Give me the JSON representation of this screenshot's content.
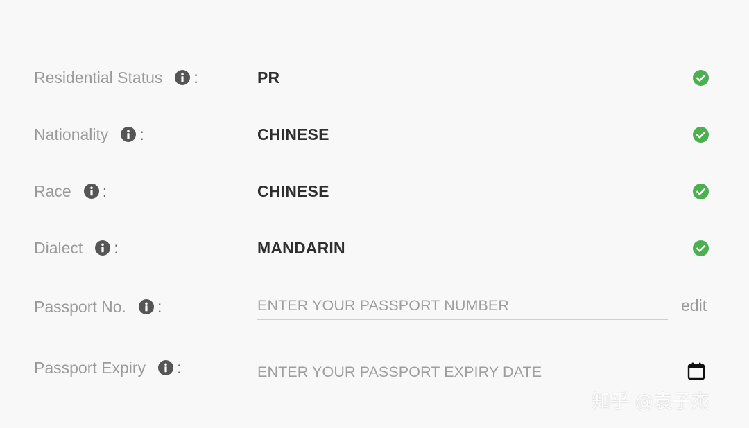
{
  "fields": [
    {
      "label": "Residential Status",
      "value": "PR",
      "status": "verified"
    },
    {
      "label": "Nationality",
      "value": "CHINESE",
      "status": "verified"
    },
    {
      "label": "Race",
      "value": "CHINESE",
      "status": "verified"
    },
    {
      "label": "Dialect",
      "value": "MANDARIN",
      "status": "verified"
    },
    {
      "label": "Passport No.",
      "value": "",
      "placeholder": "ENTER YOUR PASSPORT NUMBER",
      "action": "edit"
    },
    {
      "label": "Passport Expiry",
      "value": "",
      "placeholder": "ENTER YOUR PASSPORT EXPIRY DATE",
      "action_icon": "calendar-icon"
    }
  ],
  "separator": ":",
  "icons": {
    "info": "info-icon",
    "check": "check-circle-icon",
    "calendar": "calendar-icon"
  },
  "colors": {
    "background": "#f8f8f8",
    "label": "#9a9a9a",
    "value": "#2e2e2e",
    "check": "#4caf50",
    "info": "#555555"
  },
  "watermark": "知乎 @袁子杰"
}
